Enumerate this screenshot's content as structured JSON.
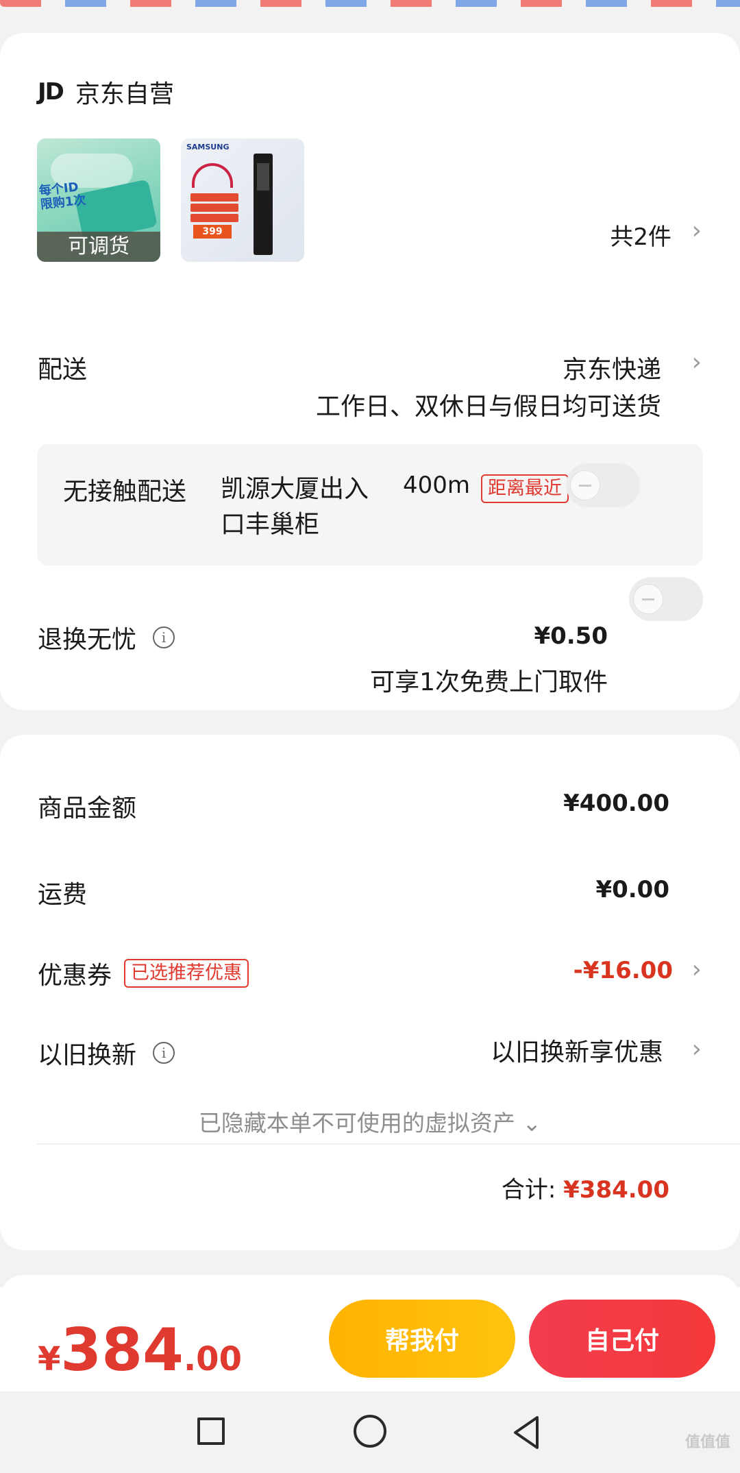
{
  "store": {
    "logo": "JD",
    "name": "京东自营"
  },
  "items": {
    "thumb1_promo_line1": "每个ID",
    "thumb1_promo_line2": "限购1次",
    "thumb1_tag": "可调货",
    "thumb2_brand": "SAMSUNG",
    "thumb2_price": "399",
    "count": "共2件"
  },
  "delivery": {
    "label": "配送",
    "method": "京东快递",
    "schedule": "工作日、双休日与假日均可送货"
  },
  "contactless": {
    "label": "无接触配送",
    "address": "凯源大厦出入口丰巢柜",
    "distance": "400m",
    "badge": "距离最近"
  },
  "return_service": {
    "label": "退换无忧",
    "price": "¥0.50",
    "desc": "可享1次免费上门取件"
  },
  "costs": {
    "goods_label": "商品金额",
    "goods_value": "¥400.00",
    "shipping_label": "运费",
    "shipping_value": "¥0.00",
    "coupon_label": "优惠券",
    "coupon_badge": "已选推荐优惠",
    "coupon_value": "-¥16.00",
    "tradein_label": "以旧换新",
    "tradein_value": "以旧换新享优惠",
    "hidden_note": "已隐藏本单不可使用的虚拟资产 ⌄",
    "total_label": "合计:",
    "total_value": "¥384.00"
  },
  "bottom": {
    "currency": "¥",
    "price_int": "384",
    "price_dec": ".00",
    "help_pay": "帮我付",
    "self_pay": "自己付"
  },
  "watermark": "值值值",
  "colors": {
    "accent_red": "#e0392f",
    "help_yellow": "#ffb300",
    "self_red": "#f23d4f"
  }
}
